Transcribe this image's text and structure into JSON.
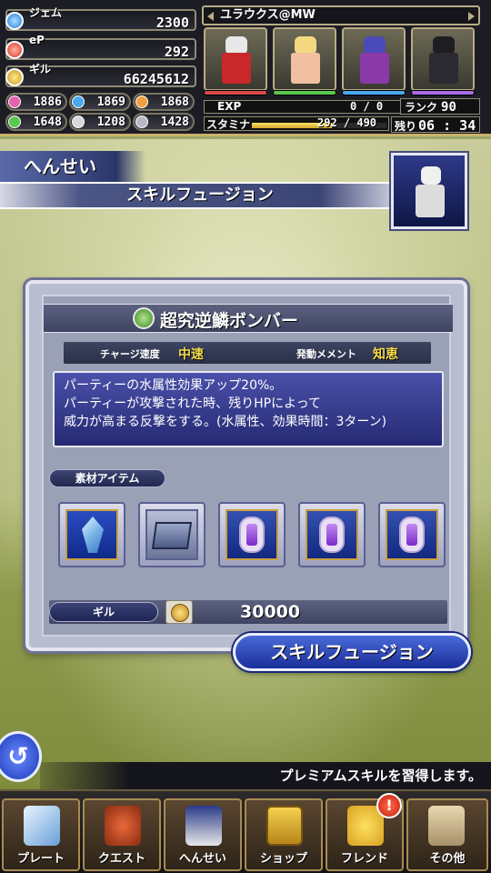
{
  "resources": {
    "gem": {
      "label": "ジェム",
      "value": "2300"
    },
    "ep": {
      "label": "eP",
      "value": "292"
    },
    "gil": {
      "label": "ギル",
      "value": "66245612"
    }
  },
  "orbs": [
    "1886",
    "1869",
    "1868",
    "1648",
    "1208",
    "1428"
  ],
  "party": {
    "name": "ユラウクス@MW",
    "exp_label": "EXP",
    "exp_value": "0 / 0",
    "rank_label": "ランク",
    "rank_value": "90",
    "stamina_label": "スタミナ",
    "stamina_value": "292 / 490",
    "stamina_fraction": 0.596,
    "remaining_label": "残り",
    "remaining_time": "06 : 34"
  },
  "screen": {
    "category": "へんせい",
    "title": "スキルフュージョン"
  },
  "skill": {
    "name": "超究逆鱗ボンバー",
    "charge_label": "チャージ速度",
    "charge_value": "中速",
    "meme_label": "発動メメント",
    "meme_value": "知恵",
    "description": [
      "パーティーの水属性効果アップ20%。",
      "パーティーが攻撃された時、残りHPによって",
      "威力が高まる反撃をする。(水属性、効果時間：3ターン)"
    ]
  },
  "materials": {
    "header": "素材アイテム",
    "items": [
      "crystal-icon",
      "book-icon",
      "purple-gem-icon",
      "purple-gem-icon",
      "purple-gem-icon"
    ]
  },
  "cost": {
    "label": "ギル",
    "value": "30000"
  },
  "actions": {
    "fusion": "スキルフュージョン",
    "back": "↺"
  },
  "info_text": "プレミアムスキルを習得します。",
  "nav": [
    {
      "label": "プレート",
      "icon": "crystal-icon"
    },
    {
      "label": "クエスト",
      "icon": "quest-icon"
    },
    {
      "label": "へんせい",
      "icon": "party-icon"
    },
    {
      "label": "ショップ",
      "icon": "shop-icon"
    },
    {
      "label": "フレンド",
      "icon": "chocobo-icon"
    },
    {
      "label": "その他",
      "icon": "scroll-icon"
    }
  ],
  "notification_badge": "!",
  "colors": {
    "accent_blue": "#1a2e9a",
    "gold": "#c8a040",
    "highlight_yellow": "#f4dc4a"
  }
}
